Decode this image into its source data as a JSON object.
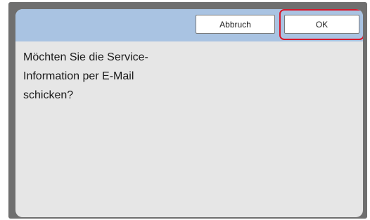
{
  "dialog": {
    "cancel_label": "Abbruch",
    "ok_label": "OK",
    "message_lines": [
      "Möchten Sie die Service-",
      "Information per E-Mail",
      "schicken?"
    ]
  },
  "colors": {
    "header": "#a9c3e2",
    "body": "#e6e6e6",
    "frame": "#6f6f6f",
    "highlight": "#d8182c"
  }
}
